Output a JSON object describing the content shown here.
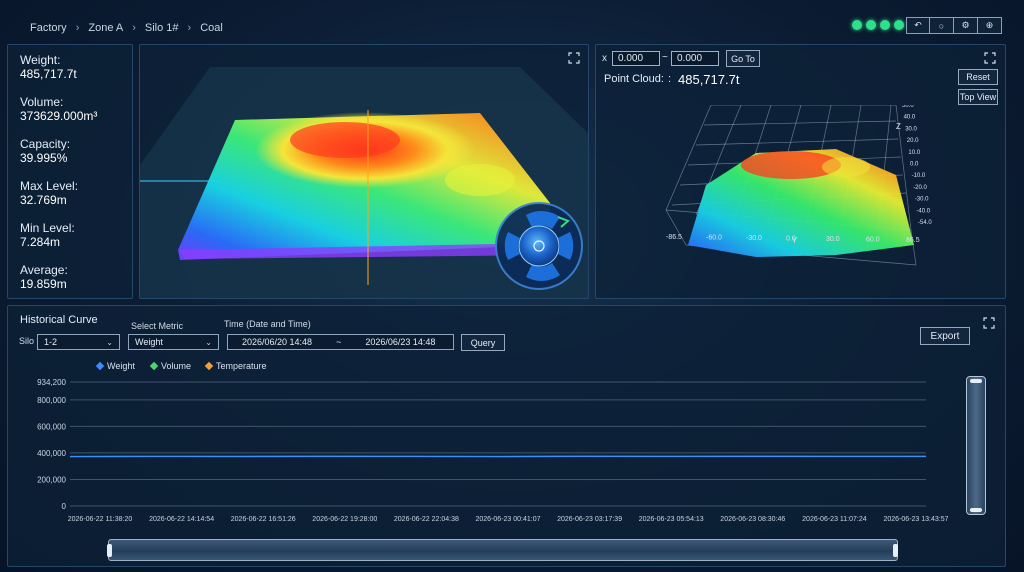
{
  "breadcrumb": {
    "items": [
      "Factory",
      "Zone A",
      "Silo 1#",
      "Coal"
    ],
    "separator": "›"
  },
  "status_dots": {
    "count": 4,
    "color": "#2fe08a"
  },
  "toolbar": {
    "buttons": [
      {
        "icon": "back-arrow-icon",
        "glyph": "↶"
      },
      {
        "icon": "refresh-icon",
        "glyph": "○"
      },
      {
        "icon": "settings-icon",
        "glyph": "⚙"
      },
      {
        "icon": "globe-icon",
        "glyph": "⊕"
      }
    ]
  },
  "stats": [
    {
      "label": "Weight:",
      "value": "485,717.7t"
    },
    {
      "label": "Volume:",
      "value": "373629.000m³"
    },
    {
      "label": "Capacity:",
      "value": "39.995%"
    },
    {
      "label": "Max Level:",
      "value": "32.769m"
    },
    {
      "label": "Min Level:",
      "value": "7.284m"
    },
    {
      "label": "Average:",
      "value": "19.859m"
    }
  ],
  "point_cloud": {
    "x_label": "x",
    "x_value": "0.000",
    "range_sep": "~",
    "y_value": "0.000",
    "goto_label": "Go To",
    "cloud_label": "Point Cloud:",
    "cloud_colon": ":",
    "cloud_value": "485,717.7t",
    "reset_label": "Reset",
    "topview_label": "Top View",
    "axis_x_ticks": [
      "-86.5",
      "-60.0",
      "-30.0",
      "0.0",
      "30.0",
      "60.0",
      "86.5"
    ],
    "axis_y_label": "Y",
    "axis_z_label": "Z",
    "axis_z_ticks": [
      "50.0",
      "40.0",
      "30.0",
      "20.0",
      "10.0",
      "0.0",
      "-10.0",
      "-20.0",
      "-30.0",
      "-40.0",
      "-54.0"
    ]
  },
  "history": {
    "title": "Historical Curve",
    "silo_label": "Silo",
    "silo_value": "1-2",
    "metric_label": "Select Metric",
    "metric_value": "Weight",
    "time_label": "Time (Date and Time)",
    "time_start": "2026/06/20 14:48",
    "time_sep": "~",
    "time_end": "2026/06/23 14:48",
    "query_label": "Query",
    "export_label": "Export"
  },
  "colors": {
    "weight": "#3b8cff",
    "volume": "#4ad66d",
    "temperature": "#f0a23a",
    "accent": "#2fe08a"
  },
  "chart_data": {
    "type": "line",
    "legend": [
      "Weight",
      "Volume",
      "Temperature"
    ],
    "y_ticks": [
      "934,200",
      "800,000",
      "600,000",
      "400,000",
      "200,000",
      "0"
    ],
    "ylim": [
      0,
      934200
    ],
    "x_ticks": [
      "2026-06-22 11:38:20",
      "2026-06-22 14:14:54",
      "2026-06-22 16:51:26",
      "2026-06-22 19:28:00",
      "2026-06-22 22:04:38",
      "2026-06-23 00:41:07",
      "2026-06-23 03:17:39",
      "2026-06-23 05:54:13",
      "2026-06-23 08:30:46",
      "2026-06-23 11:07:24",
      "2026-06-23 13:43:57"
    ],
    "series": [
      {
        "name": "Volume",
        "values": [
          373000,
          374000,
          373500,
          374200,
          373800,
          373200,
          374500,
          373900,
          374100,
          373600,
          374000
        ]
      },
      {
        "name": "Weight",
        "values": [
          372000,
          373000,
          372500,
          373200,
          372800,
          372200,
          373500,
          372900,
          373100,
          372600,
          373000
        ]
      }
    ],
    "grid": true,
    "legend_position": "top-left"
  }
}
